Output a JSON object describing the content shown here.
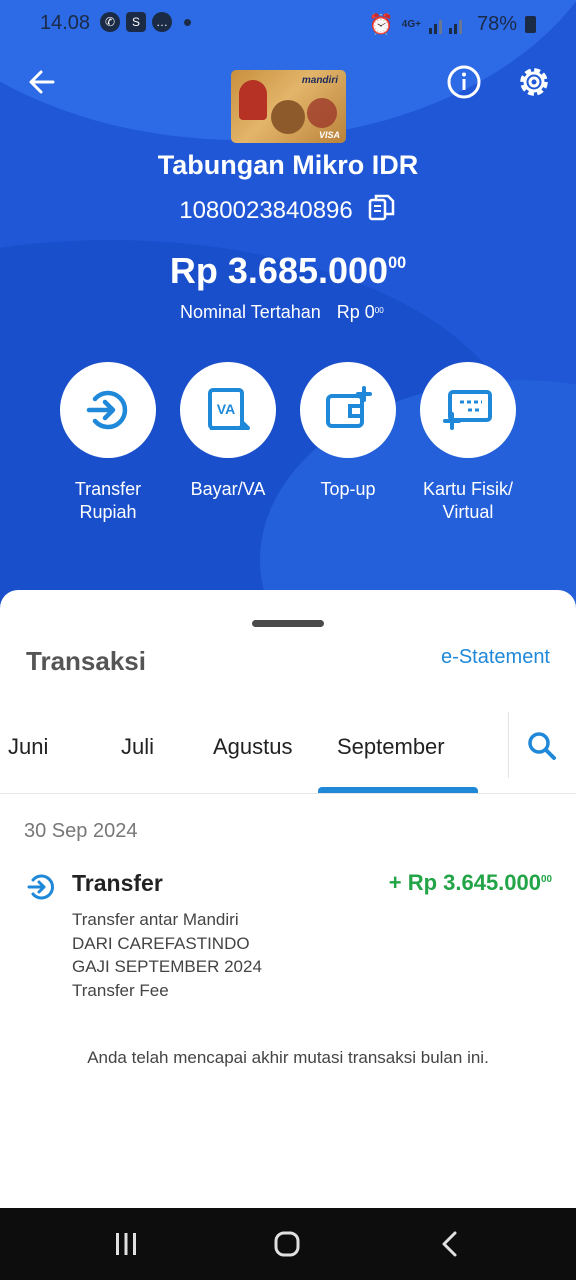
{
  "status_bar": {
    "time": "14.08",
    "network": "4G+",
    "battery": "78%"
  },
  "header": {
    "card": {
      "brand": "mandiri",
      "network": "VISA"
    },
    "account_name": "Tabungan Mikro IDR",
    "account_number": "1080023840896",
    "balance_main": "Rp 3.685.000",
    "balance_cents": "00",
    "held_label": "Nominal Tertahan",
    "held_value_main": "Rp 0",
    "held_value_cents": "00"
  },
  "actions": [
    {
      "label": "Transfer Rupiah",
      "icon": "transfer-icon"
    },
    {
      "label": "Bayar/VA",
      "icon": "va-icon"
    },
    {
      "label": "Top-up",
      "icon": "wallet-topup-icon"
    },
    {
      "label": "Kartu Fisik/ Virtual",
      "icon": "card-icon"
    }
  ],
  "sheet": {
    "title": "Transaksi",
    "e_statement": "e-Statement",
    "tabs": [
      "Juni",
      "Juli",
      "Agustus",
      "September"
    ],
    "active_tab": "September",
    "transactions": [
      {
        "date": "30 Sep 2024",
        "title": "Transfer",
        "amount_main": "+ Rp 3.645.000",
        "amount_cents": "00",
        "desc": [
          "Transfer antar Mandiri",
          "DARI CAREFASTINDO",
          "GAJI SEPTEMBER 2024",
          "Transfer Fee"
        ]
      }
    ],
    "end_note": "Anda telah mencapai akhir mutasi transaksi bulan ini."
  },
  "colors": {
    "header_blue": "#1f57d6",
    "accent": "#1f88d8",
    "credit_green": "#22a447"
  }
}
